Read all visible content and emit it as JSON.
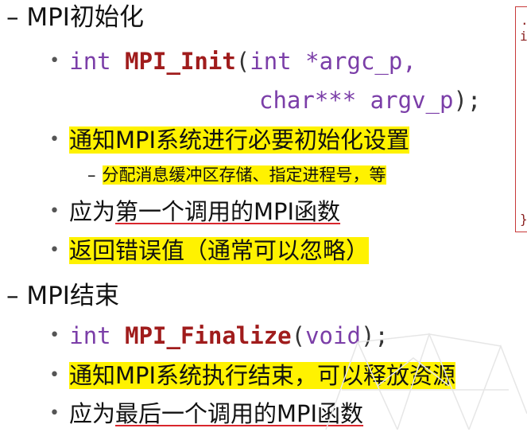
{
  "section1": {
    "dash": "–",
    "title": "MPI初始化",
    "code": {
      "kw_int": "int",
      "fn_name": "MPI_Init",
      "open": "(",
      "param1_kw": "int",
      "param1": " *argc_p,",
      "param2_kw": "char***",
      "param2": " argv_p",
      "close": ");"
    },
    "bullet1": "通知MPI系统进行必要初始化设置",
    "sub1": "分配消息缓冲区存储、指定进程号，等",
    "bullet2_prefix": "应为",
    "bullet2_underlined": "第一个调用的MPI函数",
    "bullet3": "返回错误值（通常可以忽略）"
  },
  "section2": {
    "dash": "–",
    "title": "MPI结束",
    "code": {
      "kw_int": "int",
      "fn_name": "MPI_Finalize",
      "open": "(",
      "param_kw": "void",
      "close": ");"
    },
    "bullet1": "通知MPI系统执行结束，可以释放资源",
    "bullet2_prefix": "应为",
    "bullet2_underlined": "最后一个调用的MPI函数"
  },
  "bullet_glyph": "•",
  "sub_dash": "–",
  "colors": {
    "keyword": "#7b3ea8",
    "function": "#a01c1c",
    "highlight": "#fff200",
    "underline": "#d9262c",
    "box_border": "#c83a3a"
  }
}
